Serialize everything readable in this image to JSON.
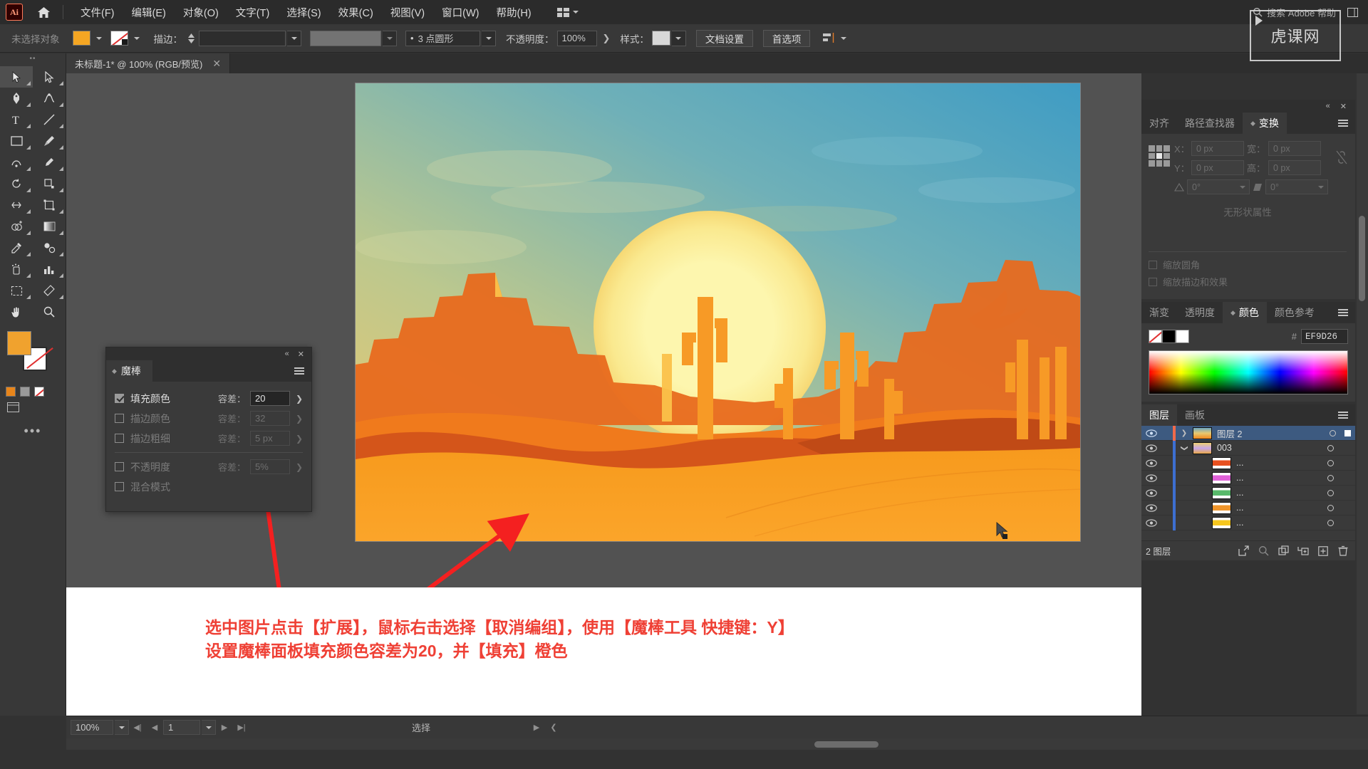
{
  "app": {
    "logo": "Ai",
    "home_icon": "home-icon",
    "search_placeholder": "搜索 Adobe 帮助"
  },
  "menubar": {
    "items": [
      {
        "label": "文件(F)"
      },
      {
        "label": "编辑(E)"
      },
      {
        "label": "对象(O)"
      },
      {
        "label": "文字(T)"
      },
      {
        "label": "选择(S)"
      },
      {
        "label": "效果(C)"
      },
      {
        "label": "视图(V)"
      },
      {
        "label": "窗口(W)"
      },
      {
        "label": "帮助(H)"
      }
    ]
  },
  "controlbar": {
    "selection_status": "未选择对象",
    "fill_color": "#F0A22E",
    "stroke_color": "none",
    "stroke_label": "描边：",
    "stroke_weight": "",
    "brush_definition": "",
    "profile": "3 点圆形",
    "opacity_label": "不透明度：",
    "opacity_value": "100%",
    "style_label": "样式：",
    "doc_setup": "文档设置",
    "preferences": "首选项"
  },
  "tab": {
    "title": "未标题-1* @ 100% (RGB/预览)",
    "close": "✕"
  },
  "toolbar": {
    "tools": [
      "selection-tool",
      "direct-selection-tool",
      "pen-tool",
      "curvature-tool",
      "type-tool",
      "line-segment-tool",
      "rectangle-tool",
      "paintbrush-tool",
      "shaper-tool",
      "blob-brush-tool",
      "rotate-tool",
      "scale-tool",
      "width-tool",
      "free-transform-tool",
      "shape-builder-tool",
      "gradient-tool",
      "eyedropper-tool",
      "blend-tool",
      "symbol-sprayer-tool",
      "column-graph-tool",
      "artboard-tool",
      "slice-tool",
      "hand-tool",
      "zoom-tool"
    ],
    "fill_color": "#F0A22E",
    "stroke_color": "#FFFFFF",
    "more_tools": "•••"
  },
  "magicwand": {
    "panel_title": "魔棒",
    "collapse_icon": "collapse-icon",
    "close_icon": "close-icon",
    "menu_icon": "panel-menu-icon",
    "rows": [
      {
        "label": "填充颜色",
        "checked": true,
        "tol_label": "容差：",
        "tol_value": "20",
        "enabled": true
      },
      {
        "label": "描边颜色",
        "checked": false,
        "tol_label": "容差：",
        "tol_value": "32",
        "enabled": false
      },
      {
        "label": "描边粗细",
        "checked": false,
        "tol_label": "容差：",
        "tol_value": "5 px",
        "enabled": false
      },
      {
        "label": "不透明度",
        "checked": false,
        "tol_label": "容差：",
        "tol_value": "5%",
        "enabled": false
      },
      {
        "label": "混合模式",
        "checked": false,
        "tol_label": "",
        "tol_value": "",
        "enabled": false
      }
    ]
  },
  "transform_panel": {
    "titlebar": {
      "collapse": "«",
      "close": "✕"
    },
    "tabs": [
      {
        "label": "对齐",
        "active": false
      },
      {
        "label": "路径查找器",
        "active": false
      },
      {
        "label": "变换",
        "active": true
      }
    ],
    "fields": {
      "x_label": "X：",
      "x_value": "0 px",
      "y_label": "Y：",
      "y_value": "0 px",
      "w_label": "宽：",
      "w_value": "0 px",
      "h_label": "高：",
      "h_value": "0 px",
      "angle_value": "0°",
      "shear_value": "0°"
    },
    "no_shape_properties": "无形状属性",
    "checkboxes": [
      {
        "label": "缩放圆角",
        "checked": false
      },
      {
        "label": "缩放描边和效果",
        "checked": false
      }
    ]
  },
  "color_panel": {
    "tabs": [
      {
        "label": "渐变",
        "active": false
      },
      {
        "label": "透明度",
        "active": false
      },
      {
        "label": "颜色",
        "active": true
      },
      {
        "label": "颜色参考",
        "active": false
      }
    ],
    "hash": "#",
    "hex_value": "EF9D26",
    "swatches": [
      "none",
      "#000000",
      "#FFFFFF"
    ]
  },
  "layers_panel": {
    "tabs": [
      {
        "label": "图层",
        "active": true
      },
      {
        "label": "画板",
        "active": false
      }
    ],
    "rows": [
      {
        "name": "图层 2",
        "selected": true,
        "expanded": false,
        "indent": 0,
        "color": "#f06a4b",
        "thumb": "artwork",
        "has_disclosure": true
      },
      {
        "name": "003",
        "selected": false,
        "expanded": true,
        "indent": 1,
        "color": "#3d6fd1",
        "thumb": "group",
        "has_disclosure": true
      },
      {
        "name": "...",
        "selected": false,
        "expanded": false,
        "indent": 2,
        "color": "#3d6fd1",
        "thumb": "#e8501f",
        "has_disclosure": false
      },
      {
        "name": "...",
        "selected": false,
        "expanded": false,
        "indent": 2,
        "color": "#3d6fd1",
        "thumb": "#e060d8",
        "has_disclosure": false
      },
      {
        "name": "...",
        "selected": false,
        "expanded": false,
        "indent": 2,
        "color": "#3d6fd1",
        "thumb": "#58b96a",
        "has_disclosure": false
      },
      {
        "name": "...",
        "selected": false,
        "expanded": false,
        "indent": 2,
        "color": "#3d6fd1",
        "thumb": "#f0952a",
        "has_disclosure": false
      },
      {
        "name": "...",
        "selected": false,
        "expanded": false,
        "indent": 2,
        "color": "#3d6fd1",
        "thumb": "#f6c61e",
        "has_disclosure": false
      }
    ],
    "footer_count": "2 图层",
    "footer_icons": [
      "locate-object-icon",
      "search-icon",
      "make-clipping-mask-icon",
      "create-sublayer-icon",
      "create-layer-icon",
      "delete-layer-icon"
    ]
  },
  "statusbar": {
    "zoom": "100%",
    "page": "1",
    "status_text": "选择"
  },
  "annotation": {
    "line1": "选中图片点击【扩展】，鼠标右击选择【取消编组】，使用【魔棒工具 快捷键：Y】",
    "line2": "设置魔棒面板填充颜色容差为20，并【填充】橙色",
    "color": "#EF4035"
  },
  "watermark": {
    "text": "虎课网"
  },
  "artwork": {
    "description": "desert sunset illustration with cacti, mesas, birds and large sun",
    "sky_top": "#56a4c0",
    "sky_mid": "#bcc98f",
    "sun": "#fdf4a8",
    "sand": "#f6941e",
    "mesa": "#d65a18"
  }
}
